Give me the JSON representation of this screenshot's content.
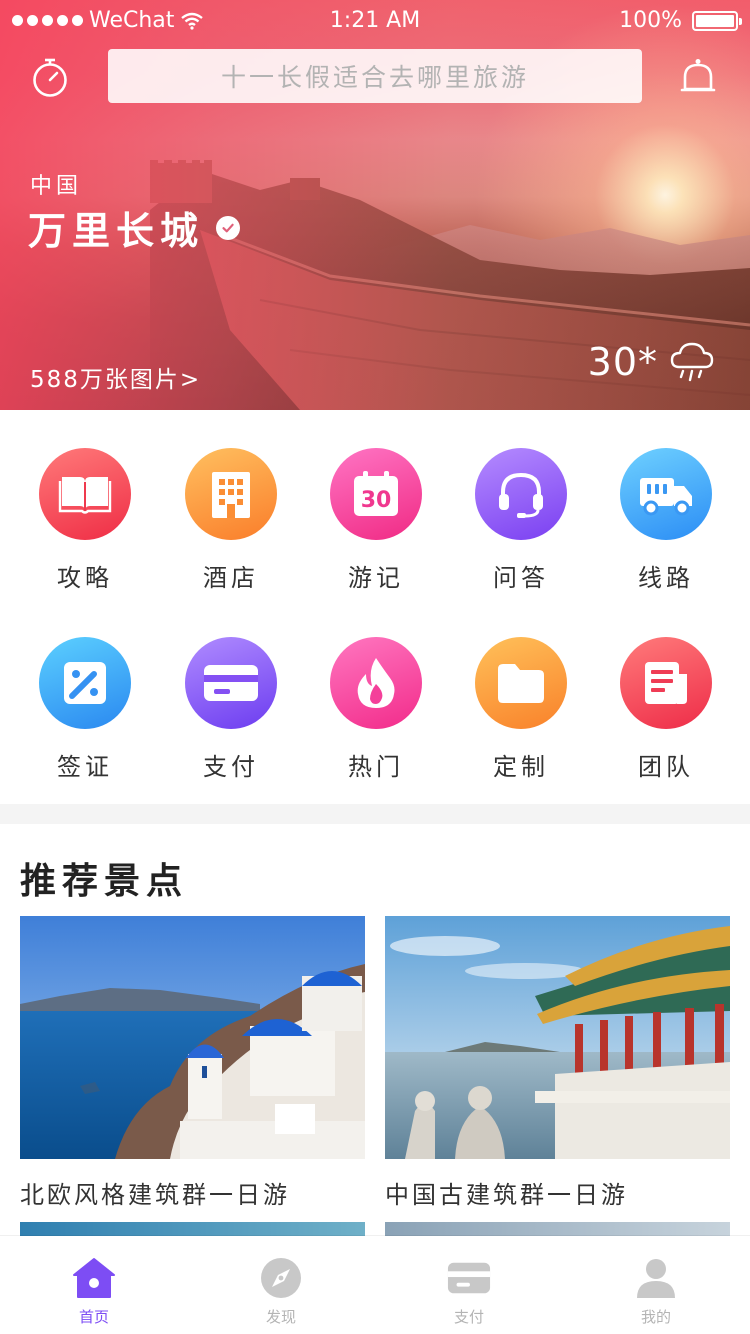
{
  "status_bar": {
    "carrier": "WeChat",
    "time": "1:21 AM",
    "battery": "100%"
  },
  "header": {
    "search_placeholder": "十一长假适合去哪里旅游"
  },
  "hero": {
    "country": "中国",
    "place": "万里长城",
    "photos_link": "588万张图片>",
    "temperature": "30*",
    "weather_icon": "rain-cloud-icon"
  },
  "grid": {
    "items": [
      {
        "label": "攻略",
        "icon": "book-icon",
        "color_from": "#ff7a7a",
        "color_to": "#ef2d45"
      },
      {
        "label": "酒店",
        "icon": "building-icon",
        "color_from": "#ffc060",
        "color_to": "#fa7d2a"
      },
      {
        "label": "游记",
        "icon": "calendar-icon",
        "color_from": "#ff75c4",
        "color_to": "#f02a84"
      },
      {
        "label": "问答",
        "icon": "headset-icon",
        "color_from": "#b58cff",
        "color_to": "#7a3ff1"
      },
      {
        "label": "线路",
        "icon": "truck-icon",
        "color_from": "#6fd1ff",
        "color_to": "#2b8df5"
      },
      {
        "label": "签证",
        "icon": "pencil-ruler-icon",
        "color_from": "#5cd0ff",
        "color_to": "#2a88f0"
      },
      {
        "label": "支付",
        "icon": "card-icon",
        "color_from": "#b08cff",
        "color_to": "#6c3cf0"
      },
      {
        "label": "热门",
        "icon": "flame-icon",
        "color_from": "#ff77c0",
        "color_to": "#f22b8a"
      },
      {
        "label": "定制",
        "icon": "folder-icon",
        "color_from": "#ffc15a",
        "color_to": "#f9812a"
      },
      {
        "label": "团队",
        "icon": "newspaper-icon",
        "color_from": "#ff7b7b",
        "color_to": "#ee2c48"
      }
    ]
  },
  "recommended": {
    "title": "推荐景点",
    "cards": [
      {
        "caption": "北欧风格建筑群一日游"
      },
      {
        "caption": "中国古建筑群一日游"
      }
    ]
  },
  "tabbar": {
    "tabs": [
      {
        "label": "首页",
        "icon": "home-icon",
        "active": true
      },
      {
        "label": "发现",
        "icon": "compass-icon",
        "active": false
      },
      {
        "label": "支付",
        "icon": "wallet-icon",
        "active": false
      },
      {
        "label": "我的",
        "icon": "user-icon",
        "active": false
      }
    ],
    "active_color": "#7d4df4",
    "inactive_color": "#b4b4b4"
  }
}
